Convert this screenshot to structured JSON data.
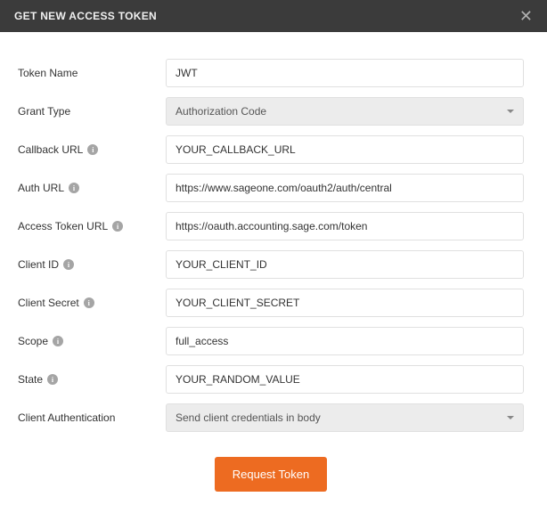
{
  "header": {
    "title": "GET NEW ACCESS TOKEN"
  },
  "form": {
    "tokenName": {
      "label": "Token Name",
      "value": "JWT"
    },
    "grantType": {
      "label": "Grant Type",
      "value": "Authorization Code"
    },
    "callbackUrl": {
      "label": "Callback URL",
      "value": "YOUR_CALLBACK_URL"
    },
    "authUrl": {
      "label": "Auth URL",
      "value": "https://www.sageone.com/oauth2/auth/central"
    },
    "accessTokenUrl": {
      "label": "Access Token URL",
      "value": "https://oauth.accounting.sage.com/token"
    },
    "clientId": {
      "label": "Client ID",
      "value": "YOUR_CLIENT_ID"
    },
    "clientSecret": {
      "label": "Client Secret",
      "value": "YOUR_CLIENT_SECRET"
    },
    "scope": {
      "label": "Scope",
      "value": "full_access"
    },
    "state": {
      "label": "State",
      "value": "YOUR_RANDOM_VALUE"
    },
    "clientAuth": {
      "label": "Client Authentication",
      "value": "Send client credentials in body"
    }
  },
  "buttons": {
    "request": "Request Token"
  }
}
